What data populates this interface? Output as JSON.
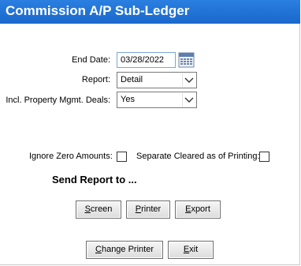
{
  "window": {
    "title": "Commission A/P Sub-Ledger"
  },
  "form": {
    "end_date_label": "End Date:",
    "end_date_value": "03/28/2022",
    "report_label": "Report:",
    "report_value": "Detail",
    "incl_property_label": "Incl. Property Mgmt. Deals:",
    "incl_property_value": "Yes",
    "ignore_zero_label": "Ignore Zero Amounts:",
    "ignore_zero_checked": false,
    "separate_cleared_label": "Separate Cleared as of Printing:",
    "separate_cleared_checked": false
  },
  "send_report": {
    "heading": "Send Report to ...",
    "screen": {
      "mnemonic": "S",
      "rest": "creen"
    },
    "printer": {
      "mnemonic": "P",
      "rest": "rinter"
    },
    "export": {
      "mnemonic": "E",
      "rest": "xport"
    }
  },
  "footer": {
    "change_printer": {
      "mnemonic": "C",
      "rest": "hange Printer"
    },
    "exit": {
      "mnemonic": "E",
      "rest": "xit"
    }
  },
  "icons": {
    "calendar": "calendar-icon",
    "dropdown": "chevron-down-icon"
  }
}
